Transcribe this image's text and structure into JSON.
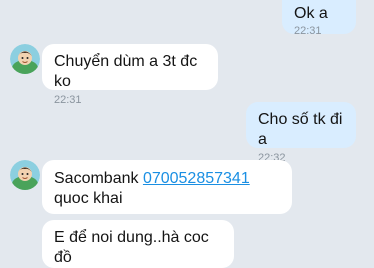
{
  "messages": [
    {
      "direction": "outgoing",
      "text": "Ok a",
      "time": "22:31"
    },
    {
      "direction": "incoming",
      "text": "Chuyển dùm a 3t đc ko",
      "time": "22:31"
    },
    {
      "direction": "outgoing",
      "text": "Cho số tk đi a",
      "time": "22:32"
    },
    {
      "direction": "incoming",
      "text_before": "Sacombank ",
      "account_number": "070052857341",
      "text_after": " quoc khai"
    },
    {
      "direction": "incoming",
      "text": "E để noi dung..hà coc đồ"
    }
  ],
  "colors": {
    "background": "#e3e8ee",
    "incoming_bubble": "#ffffff",
    "outgoing_bubble": "#d9edff",
    "link": "#1a8fe3"
  },
  "icons": {
    "sender_avatar": "avatar"
  }
}
